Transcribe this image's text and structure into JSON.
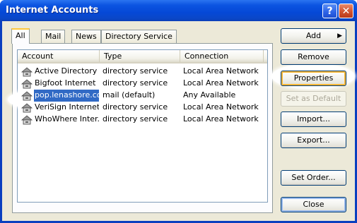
{
  "window": {
    "title": "Internet Accounts",
    "help_glyph": "?",
    "close_glyph": "✕"
  },
  "tabs": [
    {
      "label": "All",
      "active": true
    },
    {
      "label": "Mail",
      "active": false
    },
    {
      "label": "News",
      "active": false
    },
    {
      "label": "Directory Service",
      "active": false
    }
  ],
  "list": {
    "columns": [
      "Account",
      "Type",
      "Connection"
    ],
    "rows": [
      {
        "name": "Active Directory",
        "type": "directory service",
        "connection": "Local Area Network",
        "icon": "directory-service-icon",
        "selected": false
      },
      {
        "name": "Bigfoot Internet ...",
        "type": "directory service",
        "connection": "Local Area Network",
        "icon": "directory-service-icon",
        "selected": false
      },
      {
        "name": "pop.lenashore.com",
        "type": "mail (default)",
        "connection": "Any Available",
        "icon": "mail-account-icon",
        "selected": true
      },
      {
        "name": "VeriSign Internet ...",
        "type": "directory service",
        "connection": "Local Area Network",
        "icon": "directory-service-icon",
        "selected": false
      },
      {
        "name": "WhoWhere Inter...",
        "type": "directory service",
        "connection": "Local Area Network",
        "icon": "directory-service-icon",
        "selected": false
      }
    ]
  },
  "buttons": {
    "add": "Add",
    "add_arrow": "▶",
    "remove": "Remove",
    "properties": "Properties",
    "set_default": "Set as Default",
    "import": "Import...",
    "export": "Export...",
    "set_order": "Set Order...",
    "close": "Close"
  },
  "colors": {
    "title_bar": "#0548d6",
    "selection": "#316ac5",
    "dialog_bg": "#ece9d8",
    "highlight_ellipse": "#ffffff"
  }
}
